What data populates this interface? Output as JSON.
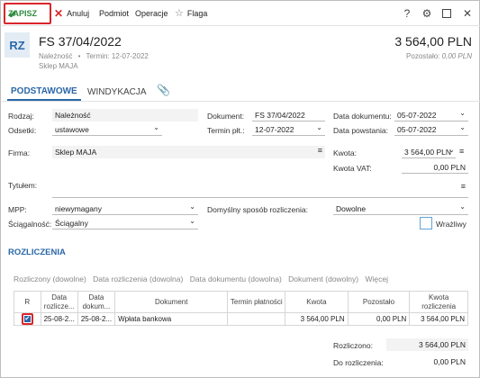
{
  "toolbar": {
    "save_label": "ZAPISZ",
    "cancel_label": "Anuluj",
    "subject_label": "Podmiot",
    "operations_label": "Operacje",
    "flag_label": "Flaga"
  },
  "window_icons": [
    "help-icon",
    "gear-icon",
    "maximize-icon",
    "close-icon"
  ],
  "header": {
    "badge": "RZ",
    "title": "FS 37/04/2022",
    "type": "Należność",
    "separator": "•",
    "term": "Termin: 12-07-2022",
    "counterparty": "Sklep MAJA",
    "amount": "3 564,00 PLN",
    "remaining_label": "Pozostało:",
    "remaining_value": "0,00 PLN"
  },
  "tabs": [
    {
      "label": "PODSTAWOWE",
      "active": true
    },
    {
      "label": "WINDYKACJA",
      "active": false
    }
  ],
  "form": {
    "rodzaj_label": "Rodzaj:",
    "rodzaj_value": "Należność",
    "odsetki_label": "Odsetki:",
    "odsetki_value": "ustawowe",
    "dokument_label": "Dokument:",
    "dokument_value": "FS 37/04/2022",
    "termin_label": "Termin płt.:",
    "termin_value": "12-07-2022",
    "data_dok_label": "Data dokumentu:",
    "data_dok_value": "05-07-2022",
    "data_pow_label": "Data powstania:",
    "data_pow_value": "05-07-2022",
    "firma_label": "Firma:",
    "firma_value": "Sklep MAJA",
    "kwota_label": "Kwota:",
    "kwota_value": "3 564,00 PLN",
    "kwota_vat_label": "Kwota VAT:",
    "kwota_vat_value": "0,00 PLN",
    "tytulem_label": "Tytułem:",
    "tytulem_value": "",
    "mpp_label": "MPP:",
    "mpp_value": "niewymagany",
    "sciagalnosc_label": "Ściągalność:",
    "sciagalnosc_value": "Ściągalny",
    "sposob_label": "Domyślny sposób rozliczenia:",
    "sposob_value": "Dowolne",
    "wrazliwy_label": "Wrażliwy"
  },
  "rozliczenia": {
    "title": "ROZLICZENIA",
    "group_by": [
      "Rozliczony (dowolne)",
      "Data rozliczenia (dowolna)",
      "Data dokumentu (dowolna)",
      "Dokument (dowolny)",
      "Więcej"
    ],
    "columns": [
      "R",
      "Data rozlicze...",
      "Data dokum...",
      "Dokument",
      "Termin płatności",
      "Kwota",
      "Pozostało",
      "Kwota rozliczenia"
    ],
    "rows": [
      {
        "checked": true,
        "data_rozl": "25-08-2...",
        "data_dok": "25-08-2...",
        "dokument": "Wpłata bankowa",
        "termin": "",
        "kwota": "3 564,00 PLN",
        "pozostalo": "0,00 PLN",
        "kwota_rozl": "3 564,00 PLN"
      }
    ],
    "rozliczono_label": "Rozliczono:",
    "rozliczono_value": "3 564,00 PLN",
    "do_rozliczenia_label": "Do rozliczenia:",
    "do_rozliczenia_value": "0,00 PLN"
  }
}
